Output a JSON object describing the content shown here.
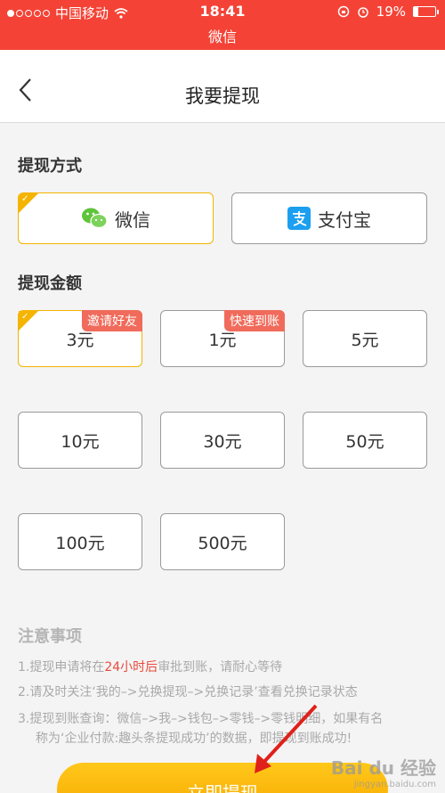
{
  "status_bar": {
    "carrier": "中国移动",
    "time": "18:41",
    "battery": "19%",
    "battery_level": 0.19,
    "app_name": "微信"
  },
  "nav": {
    "title": "我要提现"
  },
  "method": {
    "title": "提现方式",
    "options": [
      {
        "label": "微信",
        "selected": true,
        "icon": "wechat-icon"
      },
      {
        "label": "支付宝",
        "selected": false,
        "icon": "alipay-icon"
      }
    ]
  },
  "amount": {
    "title": "提现金额",
    "options": [
      {
        "label": "3元",
        "badge": "邀请好友",
        "selected": true
      },
      {
        "label": "1元",
        "badge": "快速到账",
        "selected": false
      },
      {
        "label": "5元"
      },
      {
        "label": "10元"
      },
      {
        "label": "30元"
      },
      {
        "label": "50元"
      },
      {
        "label": "100元"
      },
      {
        "label": "500元"
      }
    ]
  },
  "notes": {
    "title": "注意事项",
    "line1_pre": "1.提现申请将在",
    "line1_hl": "24小时后",
    "line1_post": "审批到账，请耐心等待",
    "line2": "2.请及时关注‘我的–>兑换提现–>兑换记录’查看兑换记录状态",
    "line3": "3.提现到账查询：微信–>我–>钱包–>零钱–>零钱明细，如果有名",
    "line4": "称为‘企业付款:趣头条提现成功’的数据，即提现到账成功!"
  },
  "submit_label": "立即提现",
  "watermark": {
    "brand": "Bai du 经验",
    "url": "jingyan.baidu.com"
  },
  "colors": {
    "status_red": "#f44336",
    "accent_yellow": "#f4b400",
    "badge_red": "#f06b5b",
    "highlight_red": "#e94a3b"
  }
}
